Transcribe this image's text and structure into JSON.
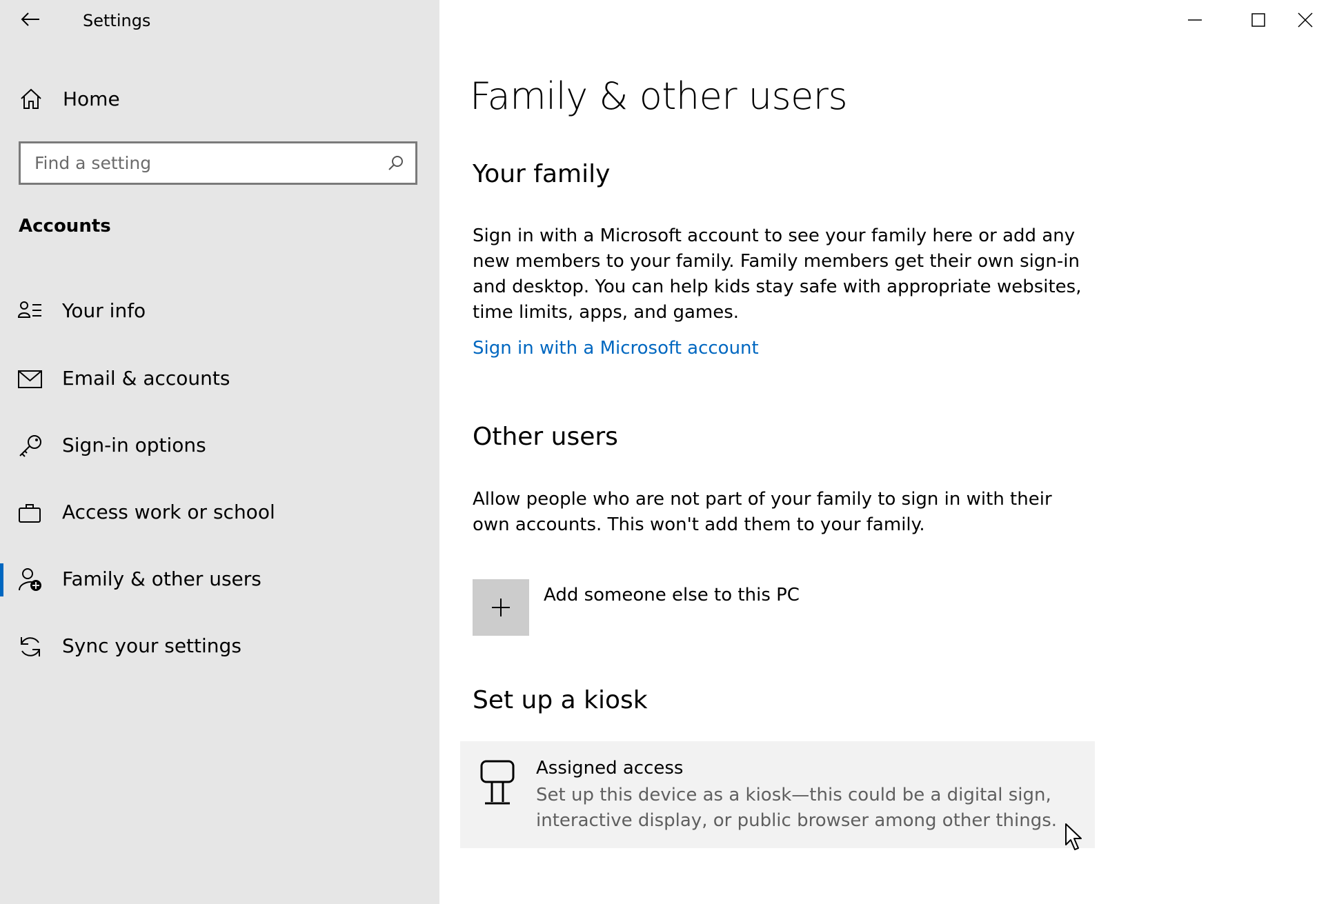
{
  "window": {
    "title": "Settings",
    "minimize_icon": "minimize-icon",
    "maximize_icon": "maximize-icon",
    "close_icon": "close-icon"
  },
  "sidebar": {
    "home_label": "Home",
    "search": {
      "placeholder": "Find a setting",
      "value": ""
    },
    "section_label": "Accounts",
    "items": [
      {
        "label": "Your info",
        "icon": "person-card-icon",
        "active": false
      },
      {
        "label": "Email & accounts",
        "icon": "mail-icon",
        "active": false
      },
      {
        "label": "Sign-in options",
        "icon": "key-icon",
        "active": false
      },
      {
        "label": "Access work or school",
        "icon": "briefcase-icon",
        "active": false
      },
      {
        "label": "Family & other users",
        "icon": "person-add-icon",
        "active": true
      },
      {
        "label": "Sync your settings",
        "icon": "sync-icon",
        "active": false
      }
    ]
  },
  "main": {
    "title": "Family & other users",
    "family": {
      "heading": "Your family",
      "description": "Sign in with a Microsoft account to see your family here or add any new members to your family. Family members get their own sign-in and desktop. You can help kids stay safe with appropriate websites, time limits, apps, and games.",
      "link": "Sign in with a Microsoft account"
    },
    "other_users": {
      "heading": "Other users",
      "description": "Allow people who are not part of your family to sign in with their own accounts. This won't add them to your family.",
      "add_label": "Add someone else to this PC"
    },
    "kiosk": {
      "heading": "Set up a kiosk",
      "card_title": "Assigned access",
      "card_description": "Set up this device as a kiosk—this could be a digital sign, interactive display, or public browser among other things."
    }
  },
  "colors": {
    "sidebar_bg": "#e6e6e6",
    "accent": "#0067c0",
    "tile_bg": "#cccccc",
    "card_bg": "#f2f2f2"
  }
}
